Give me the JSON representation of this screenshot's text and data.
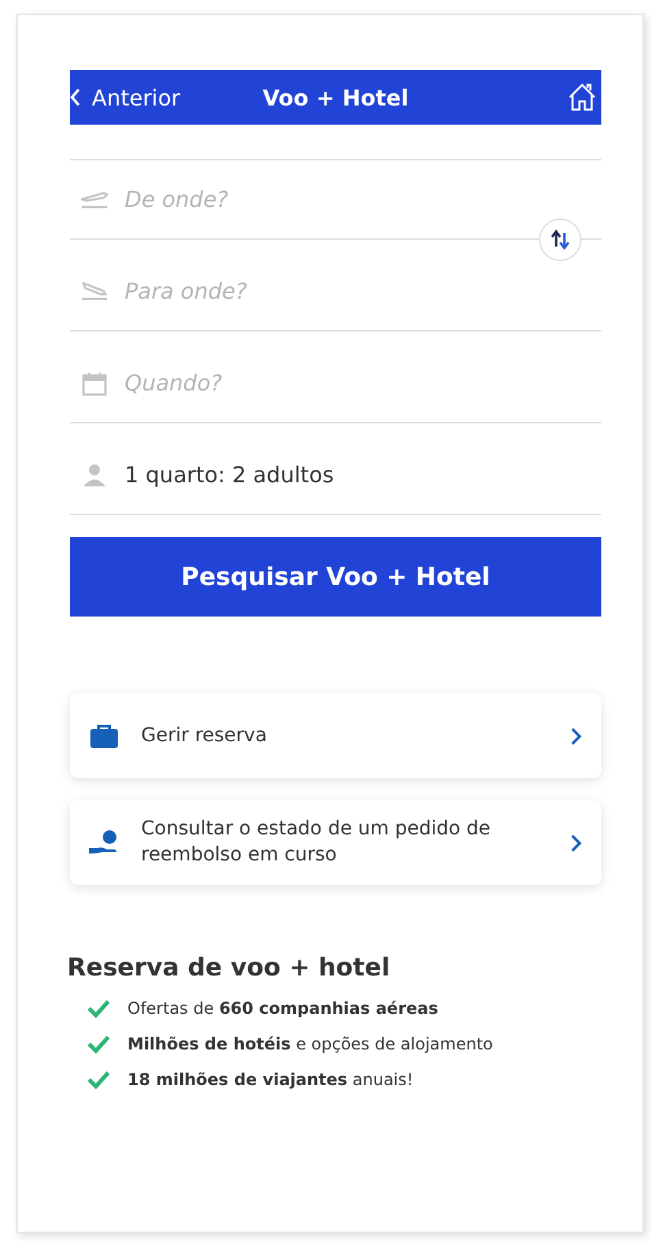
{
  "header": {
    "back": "Anterior",
    "title": "Voo + Hotel"
  },
  "fields": [
    {
      "kind": "departure",
      "placeholder": "De onde?"
    },
    {
      "kind": "arrival",
      "placeholder": "Para onde?"
    },
    {
      "kind": "date",
      "placeholder": "Quando?"
    },
    {
      "kind": "guests",
      "value": "1 quarto: 2 adultos"
    }
  ],
  "search_button": "Pesquisar Voo + Hotel",
  "links": [
    {
      "kind": "booking",
      "label": "Gerir reserva"
    },
    {
      "kind": "refund",
      "label": "Consultar o estado de um pedido de reembolso em curso"
    }
  ],
  "benefits": {
    "title": "Reserva de voo + hotel",
    "items": [
      "Ofertas de **660 companhias aéreas**",
      "**Milhões de hotéis** e opções de alojamento",
      "**18 milhões de viajantes** anuais!"
    ]
  }
}
